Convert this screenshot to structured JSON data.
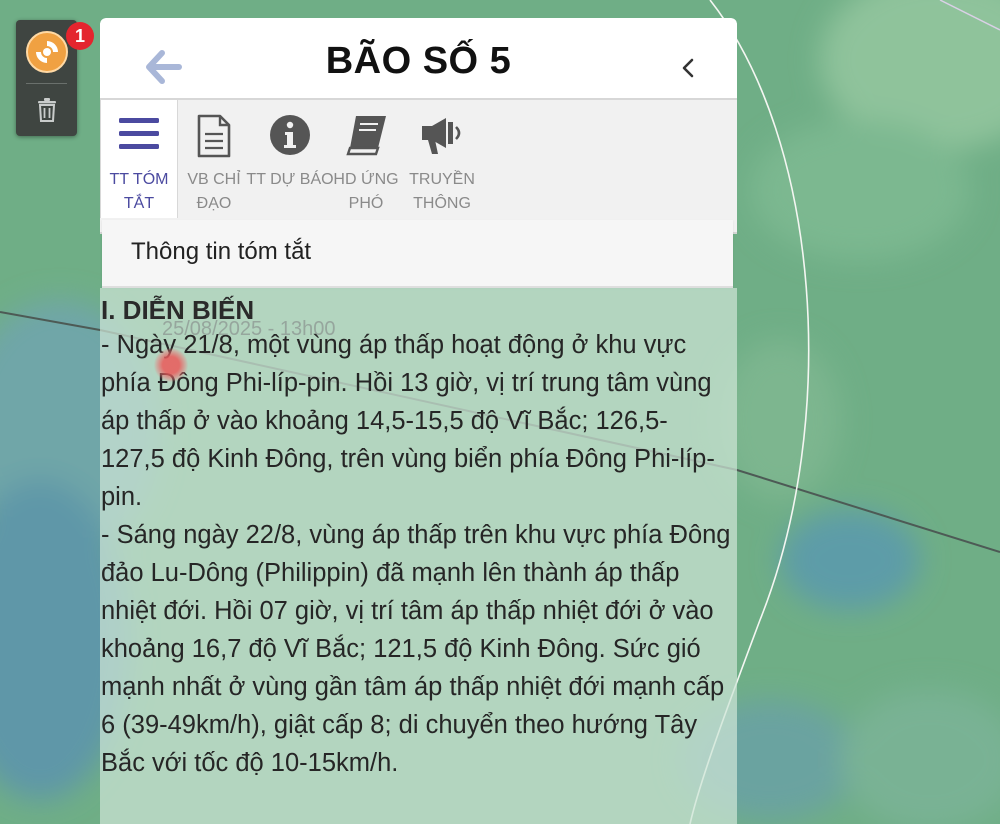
{
  "panel": {
    "title": "BÃO SỐ 5"
  },
  "tabs": [
    {
      "label": "TT TÓM TẮT",
      "icon": "hamburger-menu-icon",
      "active": true
    },
    {
      "label": "VB CHỈ ĐẠO",
      "icon": "document-icon",
      "active": false
    },
    {
      "label": "TT DỰ BÁO",
      "icon": "info-icon",
      "active": false
    },
    {
      "label": "HD ỨNG PHÓ",
      "icon": "book-icon",
      "active": false
    },
    {
      "label": "TRUYỀN THÔNG",
      "icon": "megaphone-icon",
      "active": false
    }
  ],
  "section": {
    "title": "Thông tin tóm tắt"
  },
  "content": {
    "heading": "I. DIỄN BIẾN",
    "paragraphs": [
      "- Ngày 21/8, một vùng áp thấp hoạt động ở khu vực phía Đông Phi-líp-pin. Hồi 13 giờ, vị trí trung tâm vùng áp thấp ở vào khoảng 14,5-15,5 độ Vĩ Bắc; 126,5-127,5 độ Kinh Đông, trên vùng biển phía Đông Phi-líp-pin.",
      "- Sáng ngày 22/8, vùng áp thấp trên khu vực phía Đông đảo Lu-Dông (Philippin) đã mạnh lên thành áp thấp nhiệt đới. Hồi 07 giờ, vị trí tâm áp thấp nhiệt đới ở vào khoảng 16,7 độ Vĩ Bắc; 121,5 độ Kinh Đông. Sức gió mạnh nhất ở vùng gần tâm áp thấp nhiệt đới mạnh cấp 6 (39-49km/h), giật cấp 8; di chuyển theo hướng Tây Bắc với tốc độ 10-15km/h."
    ]
  },
  "map": {
    "storm_marker_label": "25/08/2025 - 13h00"
  },
  "toolbar": {
    "notification_count": "1"
  },
  "colors": {
    "accent": "#4b4aa0",
    "badge": "#e4252e",
    "storm_icon": "#f0a142",
    "back_arrow": "#a9b7d8"
  }
}
